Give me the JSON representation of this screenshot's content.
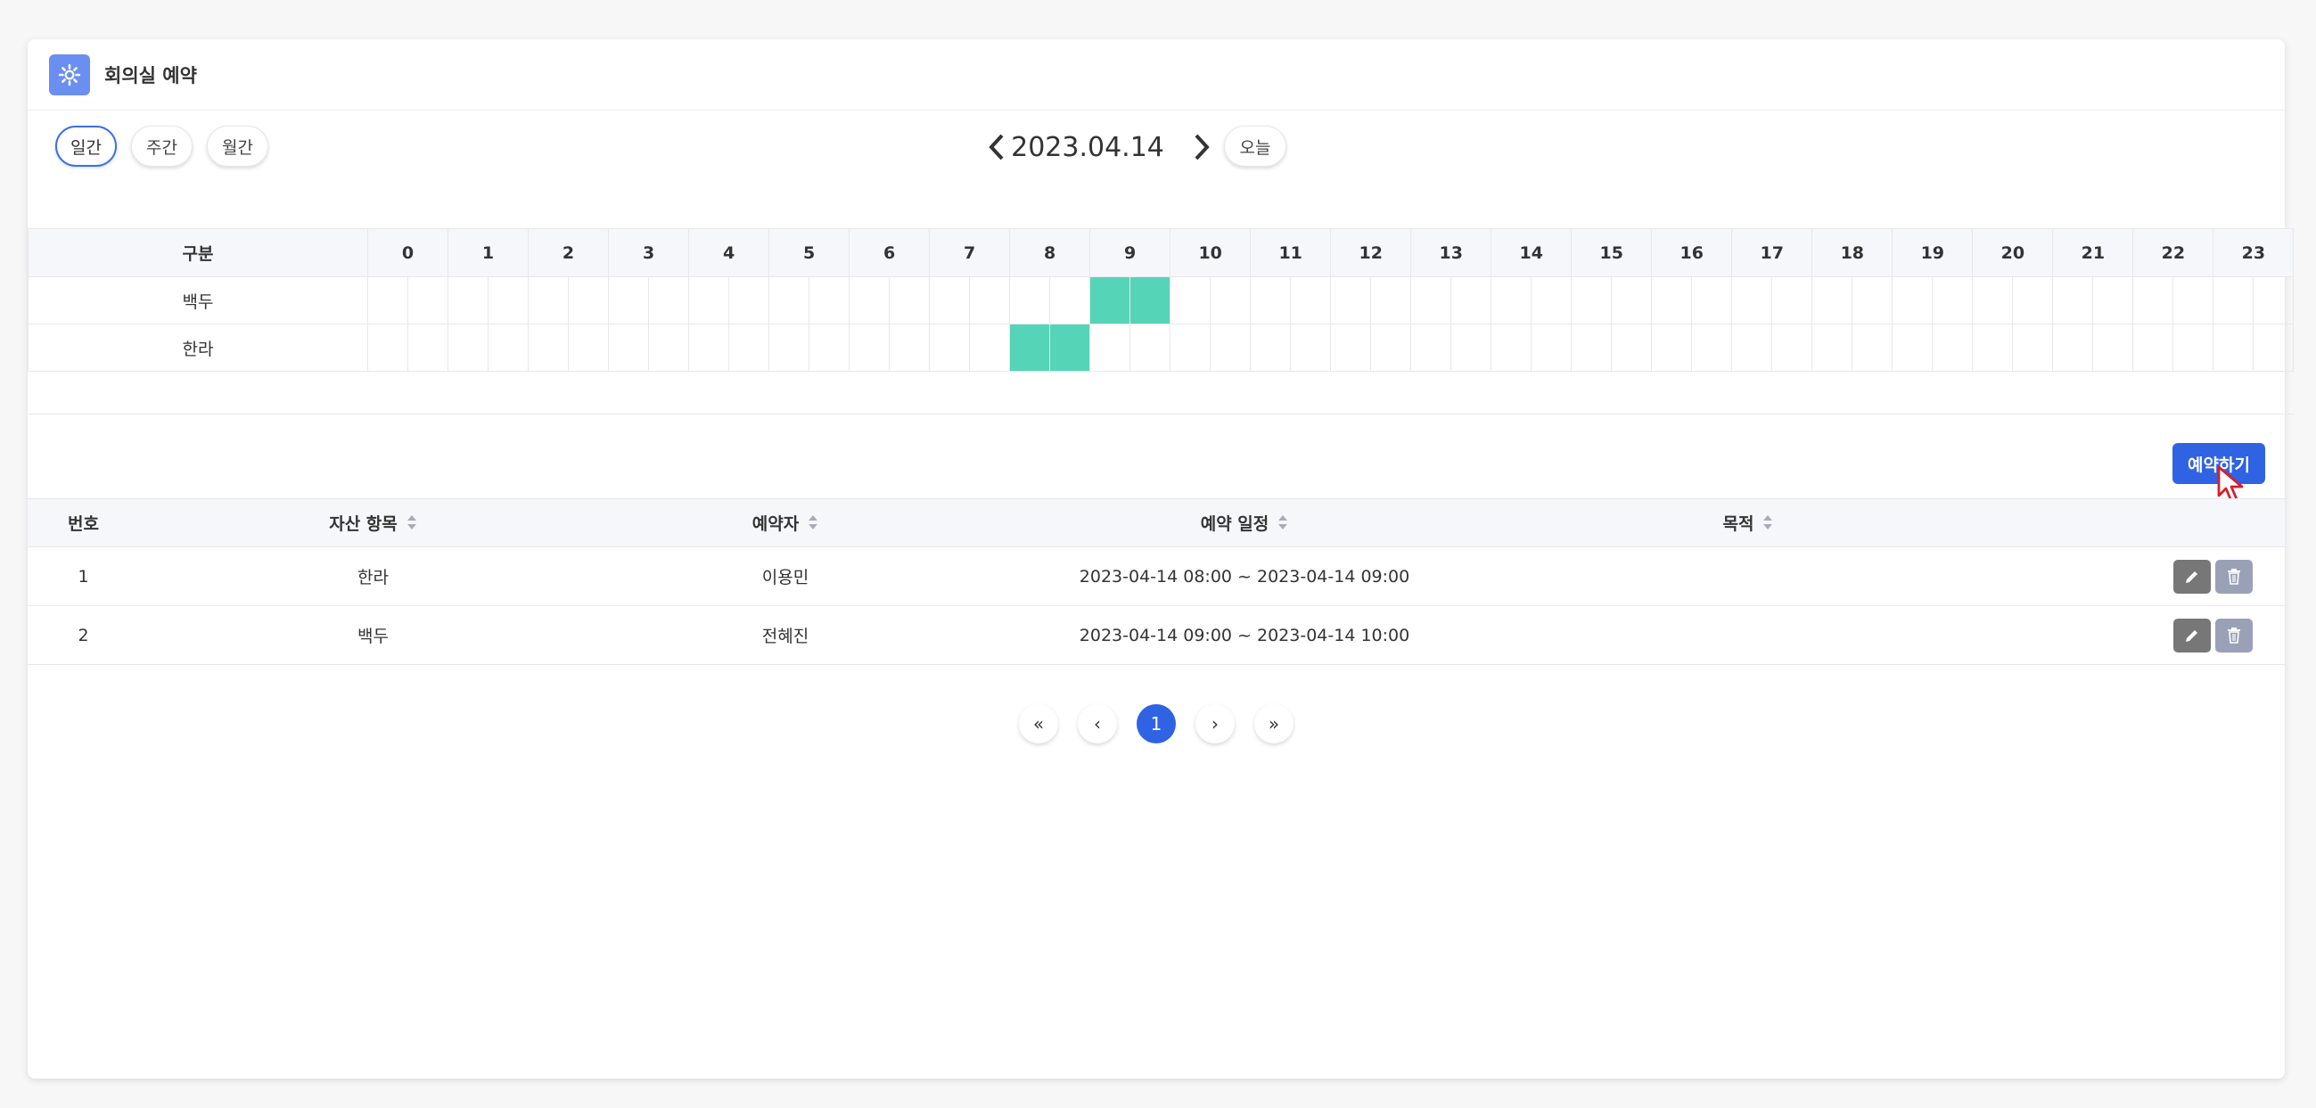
{
  "header": {
    "title": "회의실 예약",
    "icon": "gear-icon"
  },
  "toolbar": {
    "views": [
      "일간",
      "주간",
      "월간"
    ],
    "active_view": "일간",
    "date": "2023.04.14",
    "today_label": "오늘"
  },
  "timeline": {
    "header_label": "구분",
    "hours": [
      "0",
      "1",
      "2",
      "3",
      "4",
      "5",
      "6",
      "7",
      "8",
      "9",
      "10",
      "11",
      "12",
      "13",
      "14",
      "15",
      "16",
      "17",
      "18",
      "19",
      "20",
      "21",
      "22",
      "23"
    ],
    "rooms": [
      {
        "name": "백두",
        "filled_slots": [
          18,
          19
        ]
      },
      {
        "name": "한라",
        "filled_slots": [
          16,
          17
        ]
      }
    ],
    "fill_color": "#56d4b8"
  },
  "reserve_button": "예약하기",
  "list": {
    "columns": [
      "번호",
      "자산 항목",
      "예약자",
      "예약 일정",
      "목적"
    ],
    "rows": [
      {
        "no": "1",
        "asset": "한라",
        "person": "이용민",
        "schedule": "2023-04-14 08:00 ~ 2023-04-14 09:00",
        "purpose": ""
      },
      {
        "no": "2",
        "asset": "백두",
        "person": "전혜진",
        "schedule": "2023-04-14 09:00 ~ 2023-04-14 10:00",
        "purpose": ""
      }
    ]
  },
  "pagination": {
    "first": "«",
    "prev": "‹",
    "current": "1",
    "next": "›",
    "last": "»"
  },
  "colors": {
    "accent": "#2f63e3",
    "app_icon": "#6b8ff0"
  }
}
